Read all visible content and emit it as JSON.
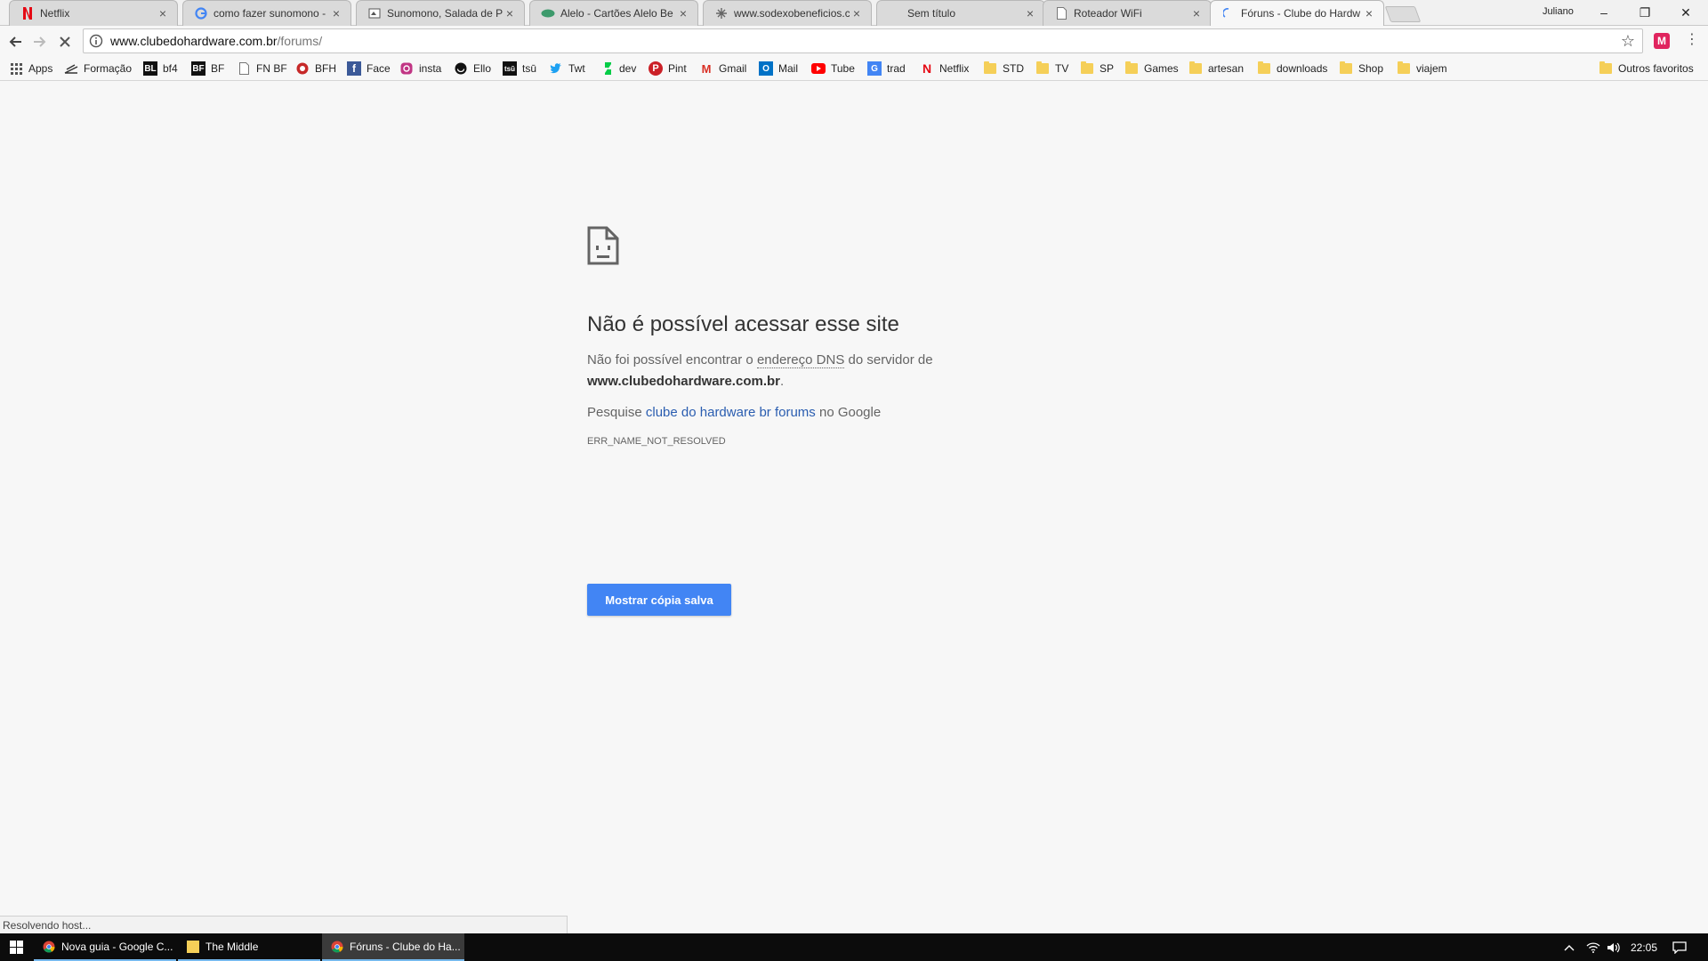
{
  "browser": {
    "tabs": [
      {
        "title": "Netflix",
        "icon": "netflix-icon"
      },
      {
        "title": "como fazer sunomono -",
        "icon": "google-icon"
      },
      {
        "title": "Sunomono, Salada de Pe",
        "icon": "site-icon"
      },
      {
        "title": "Alelo  - Cartões Alelo Be",
        "icon": "alelo-icon"
      },
      {
        "title": "www.sodexobeneficios.c",
        "icon": "loading-icon"
      },
      {
        "title": "Sem título",
        "icon": "blank-icon"
      },
      {
        "title": "Roteador WiFi",
        "icon": "page-icon"
      },
      {
        "title": "Fóruns - Clube do Hardw",
        "icon": "loading-spinner-icon",
        "active": true
      }
    ],
    "profile_name": "Juliano",
    "window_controls": {
      "minimize": "–",
      "restore": "❐",
      "close": "✕"
    },
    "address": {
      "host": "www.clubedohardware.com.br",
      "path": "/forums/"
    },
    "extension_label": "M",
    "menu_glyph": "⋮"
  },
  "bookmarks": {
    "items": [
      {
        "label": "Apps",
        "icon": "apps-grid-icon"
      },
      {
        "label": "Formação",
        "icon": "formacao-icon"
      },
      {
        "label": "bf4",
        "icon": "bl-icon",
        "badge": "BL"
      },
      {
        "label": "BF",
        "icon": "bf-icon",
        "badge": "BF"
      },
      {
        "label": "FN BF",
        "icon": "page-icon"
      },
      {
        "label": "BFH",
        "icon": "bfh-icon"
      },
      {
        "label": "Face",
        "icon": "facebook-icon",
        "badge": "f"
      },
      {
        "label": "insta",
        "icon": "instagram-icon"
      },
      {
        "label": "Ello",
        "icon": "ello-icon"
      },
      {
        "label": "tsū",
        "icon": "tsu-icon",
        "badge": "tsū"
      },
      {
        "label": "Twt",
        "icon": "twitter-icon"
      },
      {
        "label": "dev",
        "icon": "deviantart-icon"
      },
      {
        "label": "Pint",
        "icon": "pinterest-icon",
        "badge": "P"
      },
      {
        "label": "Gmail",
        "icon": "gmail-icon",
        "badge": "M"
      },
      {
        "label": "Mail",
        "icon": "outlook-icon",
        "badge": "O"
      },
      {
        "label": "Tube",
        "icon": "youtube-icon"
      },
      {
        "label": "trad",
        "icon": "translate-icon",
        "badge": "G"
      },
      {
        "label": "Netflix",
        "icon": "netflix-icon",
        "badge": "N"
      },
      {
        "label": "STD",
        "icon": "folder-icon"
      },
      {
        "label": "TV",
        "icon": "folder-icon"
      },
      {
        "label": "SP",
        "icon": "folder-icon"
      },
      {
        "label": "Games",
        "icon": "folder-icon"
      },
      {
        "label": "artesan",
        "icon": "folder-icon"
      },
      {
        "label": "downloads",
        "icon": "folder-icon"
      },
      {
        "label": "Shop",
        "icon": "folder-icon"
      },
      {
        "label": "viajem",
        "icon": "folder-icon"
      }
    ],
    "other": "Outros favoritos"
  },
  "error_page": {
    "heading": "Não é possível acessar esse site",
    "message_before": "Não foi possível encontrar o ",
    "message_abbr": "endereço DNS",
    "message_after": " do servidor de",
    "host": "www.clubedohardware.com.br",
    "host_suffix": ".",
    "search_prefix": "Pesquise ",
    "search_link": "clube do hardware br forums",
    "search_suffix": " no Google",
    "error_code": "ERR_NAME_NOT_RESOLVED",
    "button": "Mostrar cópia salva"
  },
  "status_bar": "Resolvendo host...",
  "taskbar": {
    "tasks": [
      {
        "label": "Nova guia - Google C...",
        "icon": "chrome-icon"
      },
      {
        "label": "The Middle",
        "icon": "folder-icon"
      },
      {
        "label": "Fóruns - Clube do Ha...",
        "icon": "chrome-icon",
        "active": true
      }
    ],
    "clock": "22:05"
  },
  "colors": {
    "accent_button": "#4285f4",
    "link": "#2a5db0",
    "page_bg": "#f7f7f7",
    "taskbar_bg": "#0c0c0c"
  }
}
